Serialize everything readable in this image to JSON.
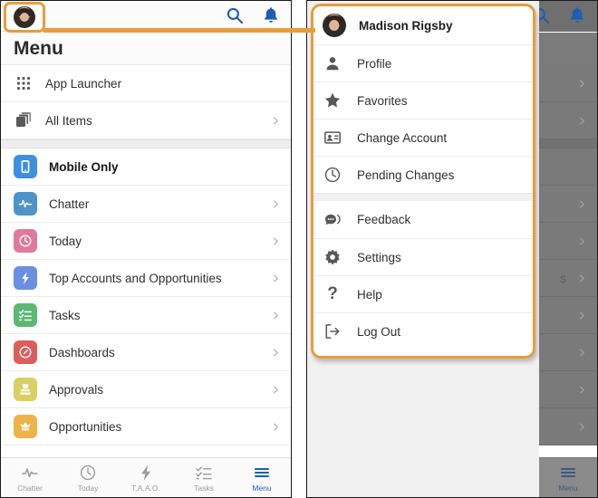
{
  "colors": {
    "highlight_orange": "#e89c3c",
    "accent_blue": "#1a5fb4",
    "mobile_only": "#3f8fe0",
    "chatter": "#4f93c8",
    "today": "#e07a9a",
    "taao": "#6a8fe0",
    "tasks": "#5cb873",
    "dashboards": "#dd5d5d",
    "approvals": "#d9d063",
    "opportunities": "#edb34a"
  },
  "left_panel": {
    "topbar": {
      "avatar_name": "avatar",
      "search_icon": "search-icon",
      "bell_icon": "notifications-bell-icon"
    },
    "title": "Menu",
    "group_one": [
      {
        "label": "App Launcher",
        "icon": "app-launcher-grid-icon",
        "chevron": false
      },
      {
        "label": "All Items",
        "icon": "all-items-stack-icon",
        "chevron": true
      }
    ],
    "group_two": [
      {
        "label": "Mobile Only",
        "icon": "mobile-device-icon",
        "color": "#3f8fe0",
        "chevron": false,
        "bold": true
      },
      {
        "label": "Chatter",
        "icon": "chatter-pulse-icon",
        "color": "#4f93c8",
        "chevron": true,
        "bold": false
      },
      {
        "label": "Today",
        "icon": "clock-icon",
        "color": "#e07a9a",
        "chevron": true,
        "bold": false
      },
      {
        "label": "Top Accounts and Opportunities",
        "icon": "lightning-bolt-icon",
        "color": "#6a8fe0",
        "chevron": true,
        "bold": false
      },
      {
        "label": "Tasks",
        "icon": "checklist-icon",
        "color": "#5cb873",
        "chevron": true,
        "bold": false
      },
      {
        "label": "Dashboards",
        "icon": "dashboard-gauge-icon",
        "color": "#dd5d5d",
        "chevron": true,
        "bold": false
      },
      {
        "label": "Approvals",
        "icon": "stamp-icon",
        "color": "#d9d063",
        "chevron": true,
        "bold": false
      },
      {
        "label": "Opportunities",
        "icon": "crown-icon",
        "color": "#edb34a",
        "chevron": true,
        "bold": false
      }
    ],
    "tabbar": [
      {
        "label": "Chatter",
        "icon": "chatter-pulse-icon",
        "active": false
      },
      {
        "label": "Today",
        "icon": "clock-icon",
        "active": false
      },
      {
        "label": "T.A.A.O.",
        "icon": "lightning-bolt-icon",
        "active": false
      },
      {
        "label": "Tasks",
        "icon": "checklist-icon",
        "active": false
      },
      {
        "label": "Menu",
        "icon": "hamburger-menu-icon",
        "active": true
      }
    ]
  },
  "right_panel": {
    "topbar": {
      "search_icon": "search-icon",
      "bell_icon": "notifications-bell-icon"
    },
    "dropdown": {
      "user_name": "Madison Rigsby",
      "items_top": [
        {
          "label": "Profile",
          "icon": "person-icon"
        },
        {
          "label": "Favorites",
          "icon": "star-icon"
        },
        {
          "label": "Change Account",
          "icon": "change-account-icon"
        },
        {
          "label": "Pending Changes",
          "icon": "clock-icon"
        }
      ],
      "items_bottom": [
        {
          "label": "Feedback",
          "icon": "feedback-bubble-icon"
        },
        {
          "label": "Settings",
          "icon": "gear-icon"
        },
        {
          "label": "Help",
          "icon": "question-mark-icon"
        },
        {
          "label": "Log Out",
          "icon": "logout-arrow-icon"
        }
      ]
    },
    "background_ghost_text": "s",
    "tabbar": [
      {
        "label": "Menu",
        "icon": "hamburger-menu-icon",
        "active": true
      }
    ]
  }
}
